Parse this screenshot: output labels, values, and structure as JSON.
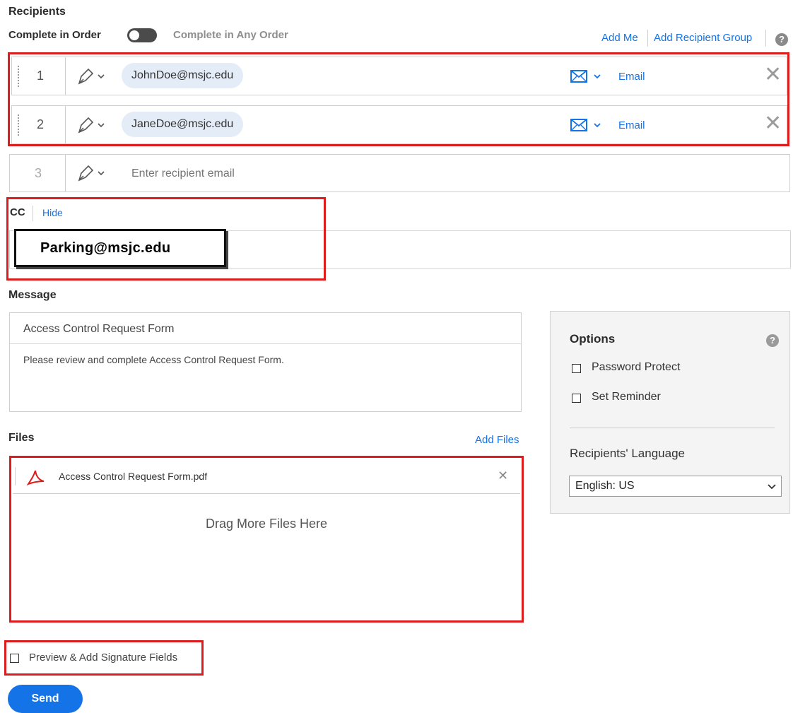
{
  "recipients": {
    "title": "Recipients",
    "order_label": "Complete in Order",
    "any_order_label": "Complete in Any Order",
    "add_me": "Add Me",
    "add_group": "Add Recipient Group",
    "rows": [
      {
        "num": "1",
        "email": "JohnDoe@msjc.edu",
        "method": "Email"
      },
      {
        "num": "2",
        "email": "JaneDoe@msjc.edu",
        "method": "Email"
      }
    ],
    "new_row": {
      "num": "3",
      "placeholder": "Enter recipient email"
    }
  },
  "cc": {
    "label": "CC",
    "hide": "Hide",
    "value": "Parking@msjc.edu"
  },
  "message": {
    "label": "Message",
    "subject": "Access Control Request Form",
    "body": "Please review and complete Access Control Request Form."
  },
  "files": {
    "label": "Files",
    "add_files": "Add Files",
    "items": [
      {
        "name": "Access Control Request Form.pdf"
      }
    ],
    "drop_text": "Drag More Files Here"
  },
  "options": {
    "title": "Options",
    "password_protect": "Password Protect",
    "set_reminder": "Set Reminder",
    "language_label": "Recipients' Language",
    "language_value": "English: US"
  },
  "preview_label": "Preview & Add Signature Fields",
  "send_label": "Send",
  "colors": {
    "accent": "#1473e6",
    "highlight": "#dd1d1d",
    "chip": "#e4ecf7"
  }
}
